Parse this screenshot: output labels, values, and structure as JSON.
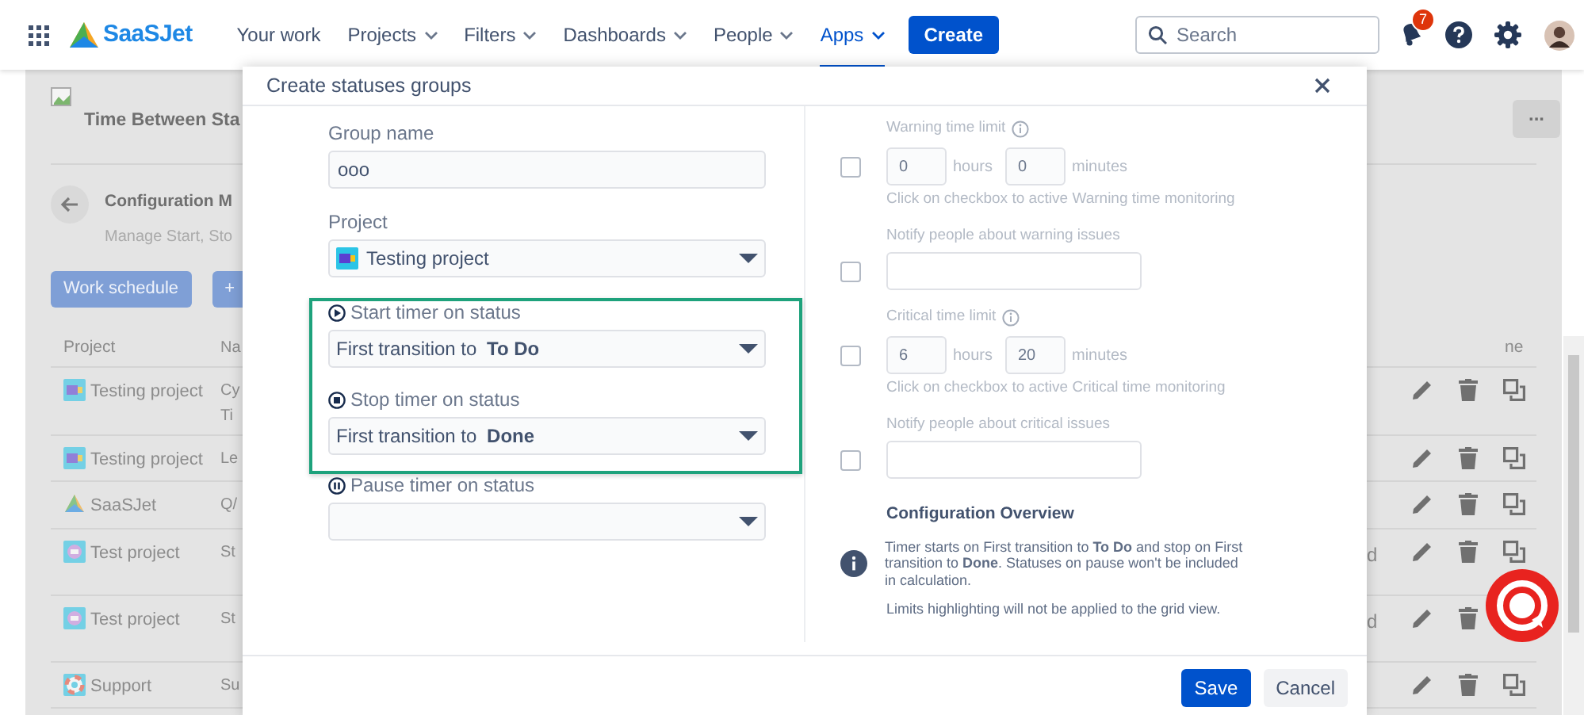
{
  "navbar": {
    "logo": "SaaSJet",
    "items": [
      {
        "label": "Your work",
        "dropdown": false,
        "selected": false
      },
      {
        "label": "Projects",
        "dropdown": true,
        "selected": false
      },
      {
        "label": "Filters",
        "dropdown": true,
        "selected": false
      },
      {
        "label": "Dashboards",
        "dropdown": true,
        "selected": false
      },
      {
        "label": "People",
        "dropdown": true,
        "selected": false
      },
      {
        "label": "Apps",
        "dropdown": true,
        "selected": true
      }
    ],
    "create_button": "Create",
    "search": {
      "placeholder": "Search"
    },
    "notification_count": "7"
  },
  "page": {
    "title": "Time Between Sta",
    "more_button": "...",
    "section_title": "Configuration M",
    "section_subtitle": "Manage Start, Sto",
    "buttons": [
      "Work schedule",
      "+"
    ],
    "table": {
      "columns": [
        "Project",
        "Na",
        "ne"
      ],
      "rows": [
        {
          "project": "Testing project",
          "kind": "testing",
          "name": [
            "Cy",
            "Ti"
          ]
        },
        {
          "project": "Testing project",
          "kind": "testing",
          "name": [
            "Le"
          ]
        },
        {
          "project": "SaaSJet",
          "kind": "saasjet",
          "name": [
            "Q/"
          ]
        },
        {
          "project": "Test project",
          "kind": "test",
          "name": [
            "St"
          ],
          "column_3": "d"
        },
        {
          "project": "Test project",
          "kind": "test",
          "name": [
            "St"
          ],
          "column_3": "d"
        },
        {
          "project": "Support",
          "kind": "support",
          "name": [
            "Su"
          ]
        }
      ]
    }
  },
  "dialog": {
    "title": "Create statuses groups",
    "group_name": {
      "label": "Group name",
      "value": "ooo"
    },
    "project": {
      "label": "Project",
      "value": "Testing project",
      "kind": "testing"
    },
    "timers": [
      {
        "kind": "start",
        "label": "Start timer on status",
        "value": "First transition to **To Do**",
        "highlighted": true
      },
      {
        "kind": "stop",
        "label": "Stop timer on status",
        "value": "First transition to **Done**",
        "highlighted": true
      },
      {
        "kind": "pause",
        "label": "Pause timer on status",
        "highlighted": false
      }
    ],
    "limits": [
      {
        "kind": "time",
        "label": "Warning time limit",
        "checked": false,
        "hours": "0",
        "hours_unit": "hours",
        "minutes": "0",
        "minutes_unit": "minutes",
        "hint": "Click on checkbox to active Warning time monitoring"
      },
      {
        "kind": "notify",
        "label": "Notify people about warning issues",
        "checked": false
      },
      {
        "kind": "time",
        "label": "Critical time limit",
        "checked": false,
        "hours": "6",
        "hours_unit": "hours",
        "minutes": "20",
        "minutes_unit": "minutes",
        "hint": "Click on checkbox to active Critical time monitoring"
      },
      {
        "kind": "notify",
        "label": "Notify people about critical issues",
        "checked": false
      }
    ],
    "overview": {
      "title": "Configuration Overview",
      "text": "Timer starts on First transition to **To Do** and stop on First transition to **Done**. Statuses on pause won't be included in calculation.",
      "note": "Limits highlighting will not be applied to the grid view."
    },
    "buttons": [
      {
        "label": "Save",
        "kind": "primary"
      },
      {
        "label": "Cancel",
        "kind": "secondary"
      }
    ]
  }
}
